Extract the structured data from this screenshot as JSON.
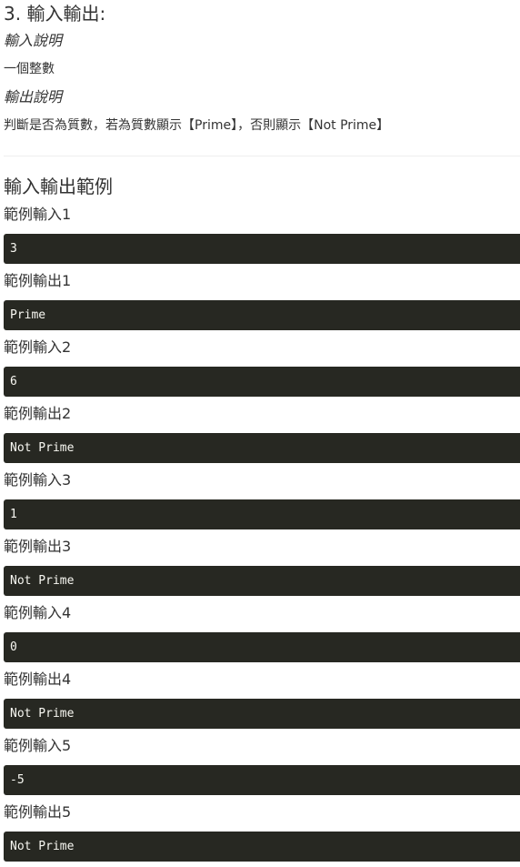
{
  "heading": "3. 輸入輸出:",
  "input_desc": {
    "title": "輸入說明",
    "text": "一個整數"
  },
  "output_desc": {
    "title": "輸出說明",
    "text": "判斷是否為質數，若為質數顯示【Prime】，否則顯示【Not Prime】"
  },
  "examples_title": "輸入輸出範例",
  "examples": [
    {
      "label": "範例輸入1",
      "code": "3"
    },
    {
      "label": "範例輸出1",
      "code": "Prime"
    },
    {
      "label": "範例輸入2",
      "code": "6"
    },
    {
      "label": "範例輸出2",
      "code": "Not Prime"
    },
    {
      "label": "範例輸入3",
      "code": "1"
    },
    {
      "label": "範例輸出3",
      "code": "Not Prime"
    },
    {
      "label": "範例輸入4",
      "code": "0"
    },
    {
      "label": "範例輸出4",
      "code": "Not Prime"
    },
    {
      "label": "範例輸入5",
      "code": "-5"
    },
    {
      "label": "範例輸出5",
      "code": "Not Prime"
    }
  ],
  "colors": {
    "code_background": "#272822",
    "code_text": "#f8f8f2",
    "text": "#333333"
  }
}
